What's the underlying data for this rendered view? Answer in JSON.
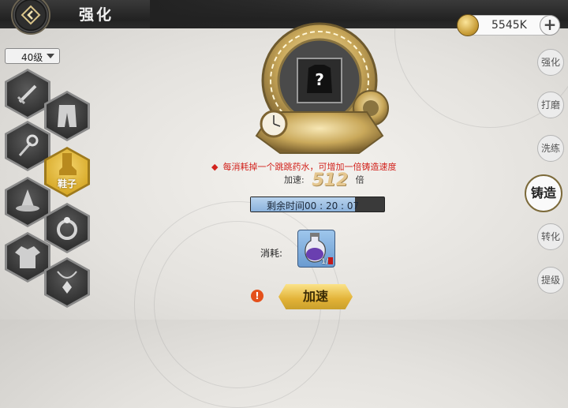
{
  "header": {
    "title": "强化"
  },
  "currency": {
    "amount": "5545K",
    "plus": "+"
  },
  "level_filter": {
    "selected": "40级"
  },
  "equipment_slots": [
    {
      "name": "weapon",
      "icon": "sword-icon"
    },
    {
      "name": "pants",
      "icon": "pants-icon"
    },
    {
      "name": "mace",
      "icon": "mace-icon"
    },
    {
      "name": "shoes",
      "icon": "boot-icon",
      "label": "鞋子",
      "selected": true
    },
    {
      "name": "hat",
      "icon": "witch-hat-icon"
    },
    {
      "name": "ring",
      "icon": "ring-icon"
    },
    {
      "name": "armor",
      "icon": "shirt-icon"
    },
    {
      "name": "necklace",
      "icon": "necklace-icon"
    }
  ],
  "right_menu": {
    "items": [
      {
        "label": "强化"
      },
      {
        "label": "打磨"
      },
      {
        "label": "洗练"
      },
      {
        "label": "铸造",
        "active": true
      },
      {
        "label": "转化"
      },
      {
        "label": "提级"
      }
    ]
  },
  "forge": {
    "info": "每消耗掉一个跳跳药水，可增加一倍铸造速度",
    "speed_label": "加速:",
    "speed_value": "512",
    "speed_unit": "倍",
    "timer_text": "剩余时间00 : 20 : 07",
    "timer_progress": 0.78,
    "consume_label": "消耗:",
    "potion_count": "1/",
    "speedup_button": "加速",
    "warn_symbol": "!"
  },
  "colors": {
    "accent_gold": "#e2b237",
    "warning": "#e4501b",
    "info_red": "#d2231d"
  }
}
